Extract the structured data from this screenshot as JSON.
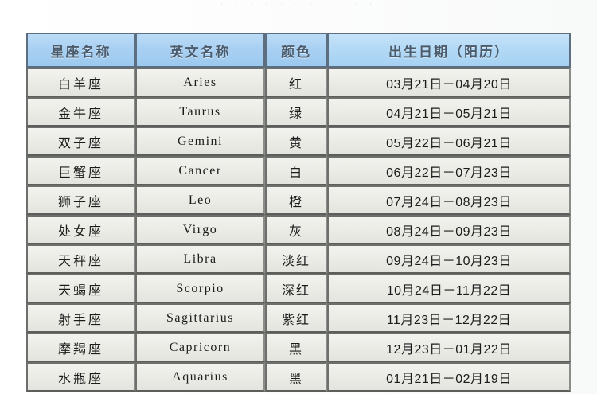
{
  "page": {
    "background_color": "#ffffff",
    "top_artifact_text": "· · · · ·     · ·     · · · ·"
  },
  "table": {
    "name": "zodiac-sign-table",
    "header_fill": "#a9d0f2",
    "header_text_color": "#4b5b6b",
    "cell_fill": "#ebebe6",
    "border_color": "#6d6f6d",
    "columns": [
      {
        "key": "name",
        "label": "星座名称"
      },
      {
        "key": "en",
        "label": "英文名称"
      },
      {
        "key": "color",
        "label": "颜色"
      },
      {
        "key": "date",
        "label": "出生日期（阳历）"
      }
    ],
    "rows": [
      {
        "name": "白羊座",
        "en": "Aries",
        "color": "红",
        "date": "03月21日－04月20日"
      },
      {
        "name": "金牛座",
        "en": "Taurus",
        "color": "绿",
        "date": "04月21日－05月21日"
      },
      {
        "name": "双子座",
        "en": "Gemini",
        "color": "黄",
        "date": "05月22日－06月21日"
      },
      {
        "name": "巨蟹座",
        "en": "Cancer",
        "color": "白",
        "date": "06月22日－07月23日"
      },
      {
        "name": "狮子座",
        "en": "Leo",
        "color": "橙",
        "date": "07月24日－08月23日"
      },
      {
        "name": "处女座",
        "en": "Virgo",
        "color": "灰",
        "date": "08月24日－09月23日"
      },
      {
        "name": "天秤座",
        "en": "Libra",
        "color": "淡红",
        "date": "09月24日－10月23日"
      },
      {
        "name": "天蝎座",
        "en": "Scorpio",
        "color": "深红",
        "date": "10月24日－11月22日"
      },
      {
        "name": "射手座",
        "en": "Sagittarius",
        "color": "紫红",
        "date": "11月23日－12月22日"
      },
      {
        "name": "摩羯座",
        "en": "Capricorn",
        "color": "黑",
        "date": "12月23日－01月22日"
      },
      {
        "name": "水瓶座",
        "en": "Aquarius",
        "color": "黑",
        "date": "01月21日－02月19日"
      }
    ]
  }
}
